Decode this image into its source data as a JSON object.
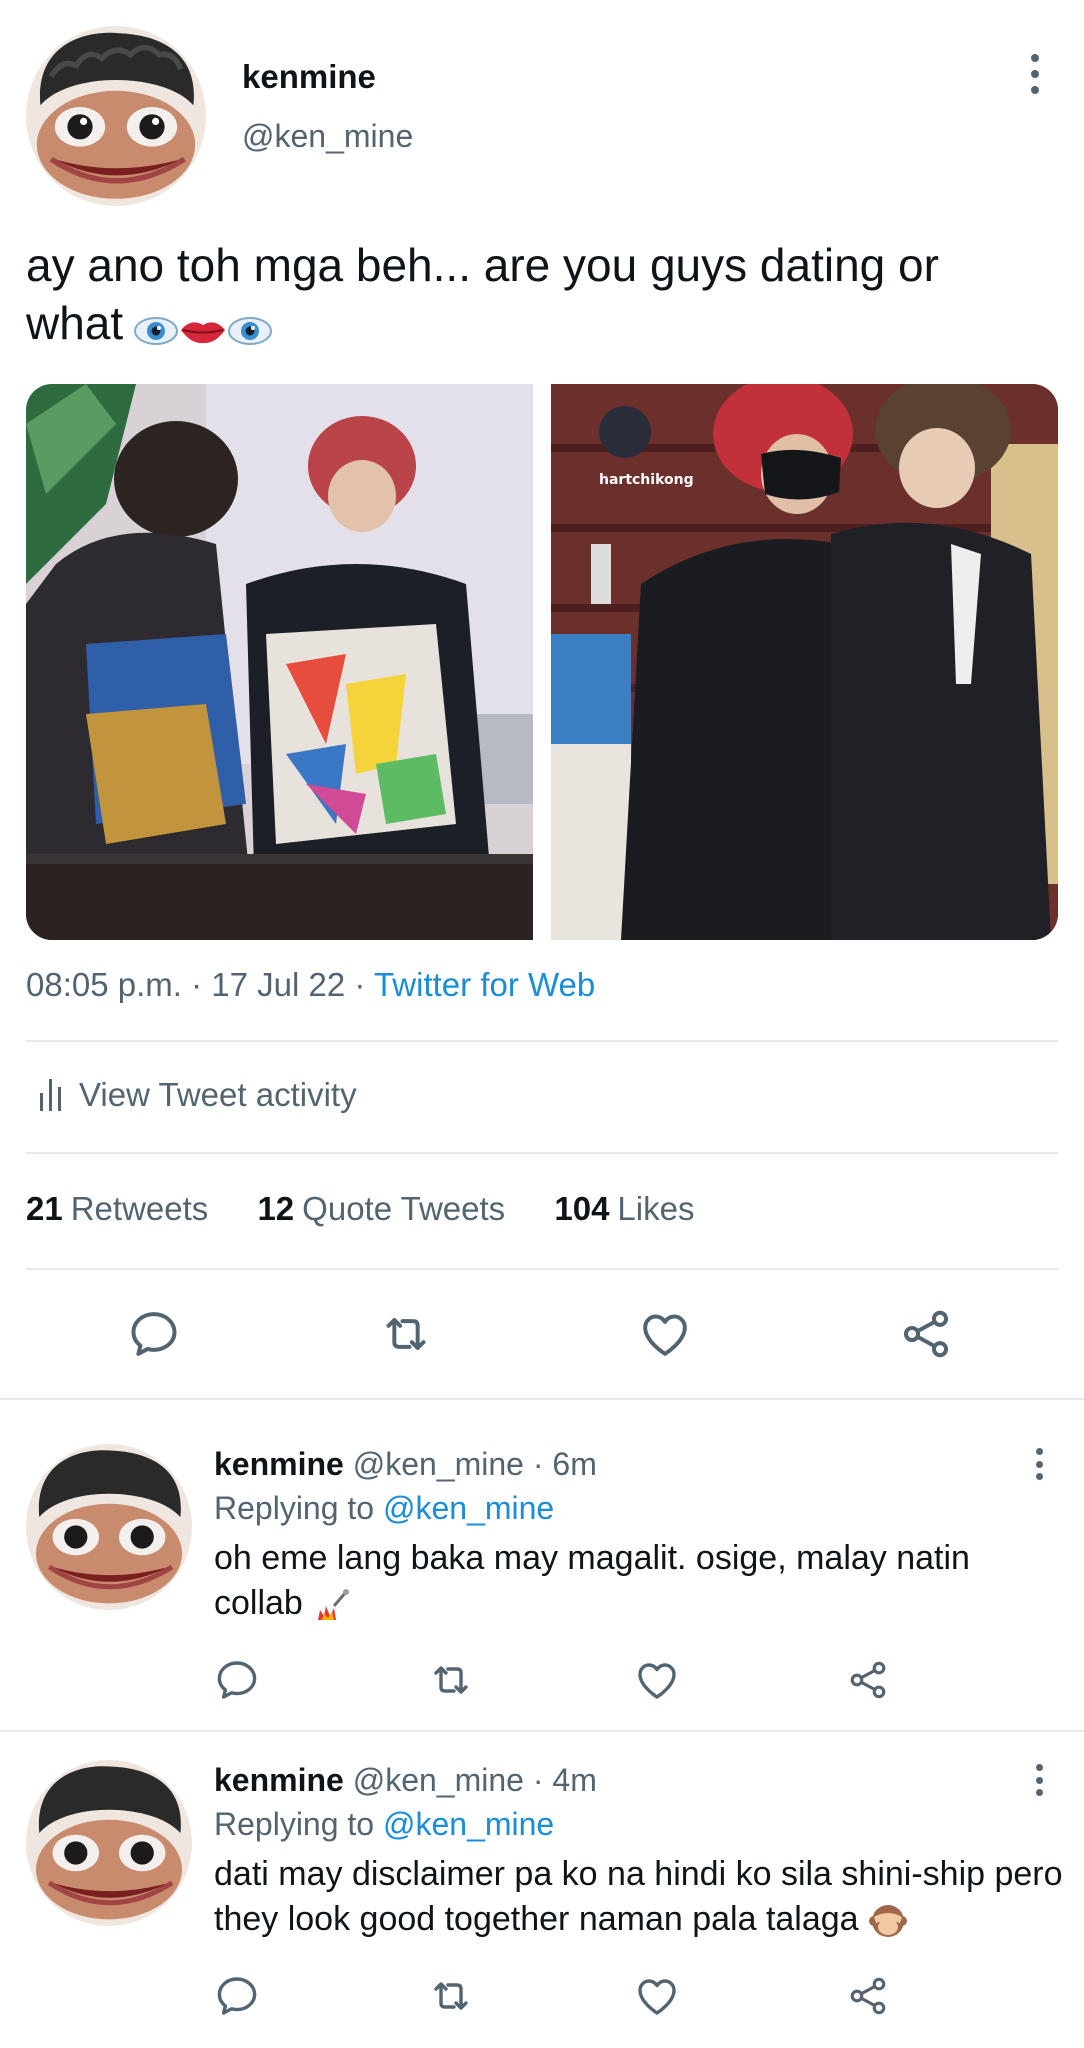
{
  "tweet": {
    "display_name": "kenmine",
    "handle": "@ken_mine",
    "text": "ay ano toh mga beh... are you guys dating or what",
    "emoji_names": [
      "eye-icon",
      "lips-icon",
      "eye-icon"
    ],
    "media_watermark": "hartchikong",
    "time": "08:05 p.m.",
    "date": "17 Jul 22",
    "separator": "·",
    "source": "Twitter for Web",
    "activity_label": "View Tweet activity",
    "stats": {
      "retweets_count": "21",
      "retweets_label": "Retweets",
      "quotes_count": "12",
      "quotes_label": "Quote Tweets",
      "likes_count": "104",
      "likes_label": "Likes"
    },
    "actions": [
      "reply-icon",
      "retweet-icon",
      "like-icon",
      "share-icon"
    ]
  },
  "replies": [
    {
      "display_name": "kenmine",
      "handle": "@ken_mine",
      "time": "· 6m",
      "replying_prefix": "Replying to",
      "replying_to": "@ken_mine",
      "text": "oh eme lang baka may magalit. osige, malay natin collab",
      "emoji_name": "firework-icon"
    },
    {
      "display_name": "kenmine",
      "handle": "@ken_mine",
      "time": "· 4m",
      "replying_prefix": "Replying to",
      "replying_to": "@ken_mine",
      "text": "dati may disclaimer pa ko na hindi ko sila shini-ship pero they look good together naman pala talaga",
      "emoji_name": "see-no-evil-monkey-icon"
    }
  ],
  "colors": {
    "text": "#0f1419",
    "secondary": "#536471",
    "link": "#1a8cd8",
    "divider": "#e4e8eb"
  }
}
